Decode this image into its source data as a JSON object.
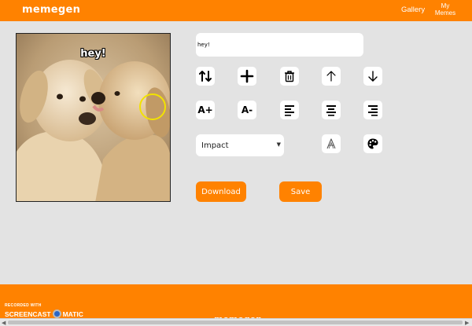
{
  "header": {
    "logo": "memegen",
    "nav_gallery": "Gallery",
    "nav_my_memes": "My Memes"
  },
  "editor": {
    "meme_text": "hey!",
    "text_input_value": "hey!",
    "font_selected": "Impact",
    "toolbar": [
      {
        "name": "switch-lines-icon",
        "icon": "up-down-arrows"
      },
      {
        "name": "add-line-icon",
        "icon": "plus"
      },
      {
        "name": "delete-line-icon",
        "icon": "trash"
      },
      {
        "name": "move-up-icon",
        "icon": "arrow-up"
      },
      {
        "name": "move-down-icon",
        "icon": "arrow-down"
      },
      {
        "name": "increase-font-icon",
        "label": "A+"
      },
      {
        "name": "decrease-font-icon",
        "label": "A-"
      },
      {
        "name": "align-left-icon",
        "icon": "align-left"
      },
      {
        "name": "align-center-icon",
        "icon": "align-center"
      },
      {
        "name": "align-right-icon",
        "icon": "align-right"
      },
      {
        "name": "stroke-color-icon",
        "icon": "outlined-A"
      },
      {
        "name": "fill-color-icon",
        "icon": "palette"
      }
    ],
    "download_label": "Download",
    "save_label": "Save"
  },
  "footer": {
    "logo": "memegen",
    "watermark_top": "RECORDED WITH",
    "watermark_left": "SCREENCAST",
    "watermark_right": "MATIC"
  },
  "colors": {
    "accent": "#ff8200",
    "background": "#e3e3e3"
  }
}
